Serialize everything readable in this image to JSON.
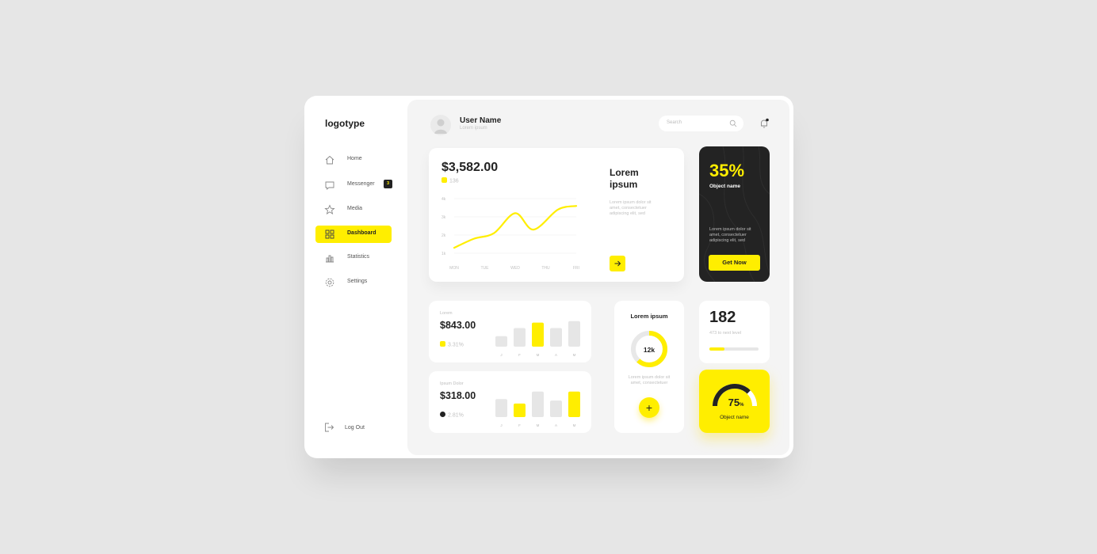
{
  "sidebar": {
    "logo": "logotype",
    "items": [
      {
        "label": "Home",
        "icon": "home-icon"
      },
      {
        "label": "Messenger",
        "icon": "message-icon",
        "badge": "3"
      },
      {
        "label": "Media",
        "icon": "star-icon"
      },
      {
        "label": "Dashboard",
        "icon": "dashboard-icon",
        "active": true
      },
      {
        "label": "Statistics",
        "icon": "statistics-icon"
      },
      {
        "label": "Settings",
        "icon": "gear-icon"
      }
    ],
    "logout": "Log Out"
  },
  "header": {
    "user_name": "User Name",
    "user_sub": "Lorem ipsum",
    "search_placeholder": "Search"
  },
  "main_card": {
    "amount": "$3,582.00",
    "change": "136",
    "title_line1": "Lorem",
    "title_line2": "ipsum",
    "description": "Lorem ipsum dolor sit amet, consectetuer adipiscing elit, sed"
  },
  "promo_card": {
    "percent": "35%",
    "object_name": "Object name",
    "description": "Lorem ipsum dolor sit amet, consectetuer adipiscing elit, sed",
    "button": "Get Now"
  },
  "bar_card_1": {
    "label": "Lorem",
    "amount": "$843.00",
    "change": "3.31%"
  },
  "bar_card_2": {
    "label": "Ipsum Dolor",
    "amount": "$318.00",
    "change": "2.81%"
  },
  "donut_card": {
    "title": "Lorem ipsum",
    "value": "12k",
    "description": "Lorem ipsum dolor sit amet, consectetuer",
    "fraction": 0.62
  },
  "level_card": {
    "number": "182",
    "description": "473 to next level",
    "progress": 0.3
  },
  "gauge_card": {
    "value": "75",
    "unit": "%",
    "object_name": "Object name",
    "fraction": 0.75
  },
  "colors": {
    "accent": "#ffee00",
    "dark": "#232323",
    "muted": "#e6e6e6"
  },
  "chart_data": [
    {
      "type": "line",
      "x": [
        "MON",
        "TUE",
        "WED",
        "THU",
        "FRI"
      ],
      "y_ticks": [
        "4k",
        "3k",
        "2k",
        "1k"
      ],
      "ylim": [
        1,
        4
      ],
      "series": [
        {
          "values": [
            1.3,
            1.8,
            2.1,
            3.2,
            2.3,
            3.4,
            3.6
          ]
        }
      ],
      "x_positions": [
        0,
        0.65,
        1.3,
        2.0,
        2.6,
        3.4,
        4.0
      ]
    },
    {
      "type": "bar",
      "categories": [
        "J",
        "F",
        "M",
        "A",
        "M"
      ],
      "values": [
        0.35,
        0.62,
        0.8,
        0.62,
        0.85
      ],
      "highlight": [
        2
      ]
    },
    {
      "type": "bar",
      "categories": [
        "J",
        "F",
        "M",
        "A",
        "M"
      ],
      "values": [
        0.6,
        0.45,
        0.85,
        0.55,
        0.85
      ],
      "highlight": [
        1,
        4
      ]
    }
  ]
}
